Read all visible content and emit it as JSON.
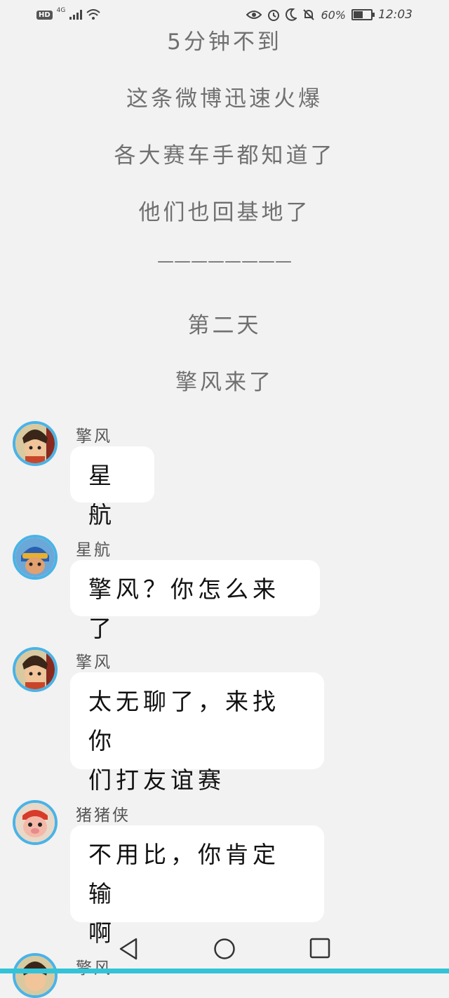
{
  "status_bar": {
    "hd": "HD",
    "network": "4G",
    "battery": "60%",
    "battery_level": 0.6,
    "time": "12:03"
  },
  "narration": [
    "5分钟不到",
    "这条微博迅速火爆",
    "各大赛车手都知道了",
    "他们也回基地了",
    "————————",
    "第二天",
    "擎风来了"
  ],
  "messages": [
    {
      "sender": "擎风",
      "lines": [
        "星航"
      ]
    },
    {
      "sender": "星航",
      "lines": [
        "擎风？你怎么来了"
      ]
    },
    {
      "sender": "擎风",
      "lines": [
        "太无聊了，来找你",
        "们打友谊赛"
      ]
    },
    {
      "sender": "猪猪侠",
      "lines": [
        "不用比，你肯定输",
        "啊"
      ]
    },
    {
      "sender": "擎风",
      "lines": []
    }
  ],
  "avatar_icons": [
    "qingfeng-avatar-icon",
    "xinghang-avatar-icon",
    "qingfeng-avatar-icon",
    "zhuzhuxia-avatar-icon",
    "qingfeng-avatar-icon"
  ],
  "nav": {
    "back": "back-icon",
    "home": "home-icon",
    "recents": "recents-icon"
  },
  "colors": {
    "background": "#f2f2f2",
    "avatar_border": "#4ab3e6",
    "accent_bar": "#33c3d9"
  }
}
